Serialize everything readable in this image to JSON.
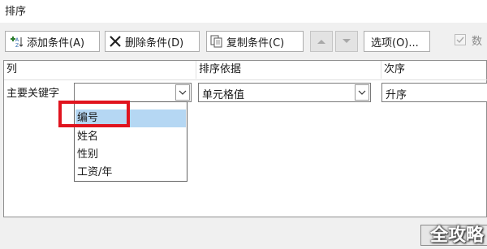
{
  "window": {
    "title": "排序"
  },
  "toolbar": {
    "add_label": "添加条件(A)",
    "delete_label": "删除条件(D)",
    "copy_label": "复制条件(C)",
    "options_label": "选项(O)...",
    "header_checkbox_label": "数"
  },
  "grid": {
    "headers": [
      "列",
      "排序依据",
      "次序"
    ],
    "row": {
      "label": "主要关键字",
      "column_value": "",
      "sort_on_value": "单元格值",
      "order_value": "升序"
    }
  },
  "dropdown": {
    "items": [
      "编号",
      "姓名",
      "性别",
      "工资/年"
    ],
    "selected": "编号"
  },
  "watermark": {
    "text": "全攻略"
  },
  "colors": {
    "highlight": "#e0141e",
    "selection": "#b5d7f3"
  }
}
